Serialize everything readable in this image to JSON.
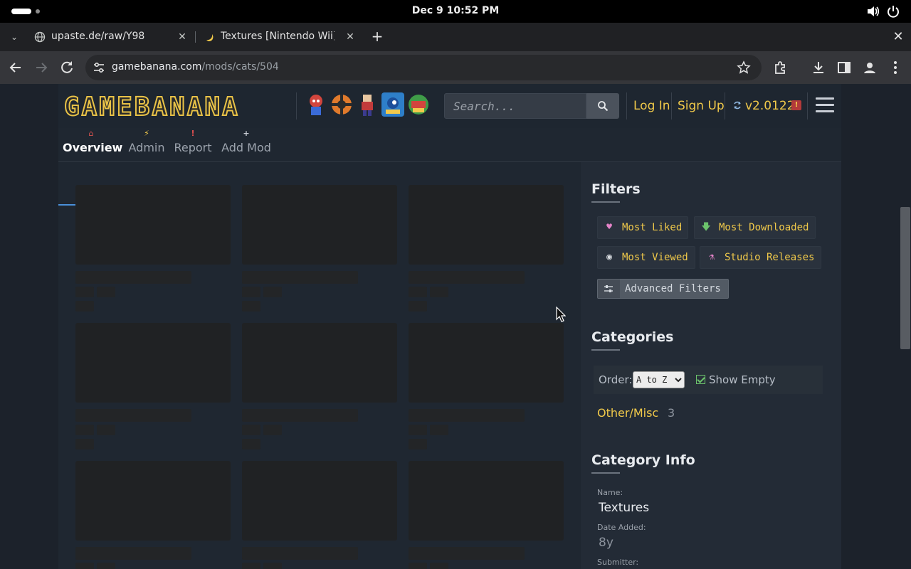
{
  "os": {
    "clock": "Dec 9  10:52 PM"
  },
  "browser": {
    "tabs": [
      {
        "title": "upaste.de/raw/Y98",
        "favicon": "globe-icon"
      },
      {
        "title": "Textures [Nintendo Wii] [",
        "favicon": "moon-icon"
      }
    ],
    "url_host": "gamebanana.com",
    "url_path": "/mods/cats/504"
  },
  "site": {
    "logo_text": "GAMEBANANA",
    "search_placeholder": "Search...",
    "login": "Log In",
    "signup": "Sign Up",
    "version": "v2.0122",
    "version_badge": "!",
    "subnav": [
      {
        "label": "Overview",
        "icon": "home-icon",
        "active": true
      },
      {
        "label": "Admin",
        "icon": "bolt-icon"
      },
      {
        "label": "Report",
        "icon": "exclamation-icon"
      },
      {
        "label": "Add Mod",
        "icon": "plus-icon"
      }
    ]
  },
  "sidebar": {
    "filters_heading": "Filters",
    "filters": [
      {
        "label": "Most Liked",
        "icon": "heart-icon"
      },
      {
        "label": "Most Downloaded",
        "icon": "download-arrow-icon"
      },
      {
        "label": "Most Viewed",
        "icon": "eye-icon"
      },
      {
        "label": "Studio Releases",
        "icon": "flask-icon"
      }
    ],
    "advanced_filters": "Advanced Filters",
    "categories_heading": "Categories",
    "order_label": "Order:",
    "order_value": "A to Z",
    "show_empty": "Show Empty",
    "category": {
      "name": "Other/Misc",
      "count": "3"
    },
    "info_heading": "Category Info",
    "info": {
      "name_label": "Name:",
      "name_value": "Textures",
      "date_label": "Date Added:",
      "date_value": "8y",
      "submitter_label": "Submitter:"
    }
  },
  "colors": {
    "accent_yellow": "#f0c94a",
    "link_blue": "#4a90d9",
    "badge_red": "#b33a3a"
  }
}
